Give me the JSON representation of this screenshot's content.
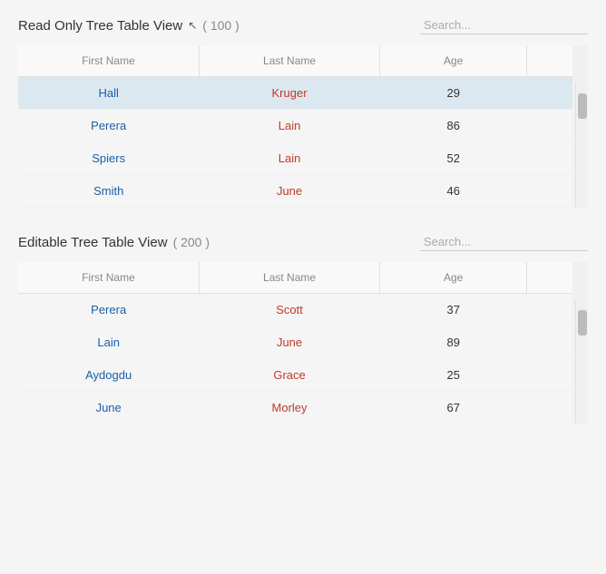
{
  "readOnly": {
    "title": "Read Only Tree Table View",
    "count": "( 100 )",
    "search": {
      "placeholder": "Search...",
      "value": ""
    },
    "columns": [
      "First Name",
      "Last Name",
      "Age"
    ],
    "rows": [
      {
        "firstName": "Hall",
        "lastName": "Kruger",
        "age": "29",
        "selected": true
      },
      {
        "firstName": "Perera",
        "lastName": "Lain",
        "age": "86",
        "selected": false
      },
      {
        "firstName": "Spiers",
        "lastName": "Lain",
        "age": "52",
        "selected": false
      },
      {
        "firstName": "Smith",
        "lastName": "June",
        "age": "46",
        "selected": false
      }
    ]
  },
  "editable": {
    "title": "Editable Tree Table View",
    "count": "( 200 )",
    "search": {
      "placeholder": "Search...",
      "value": ""
    },
    "columns": [
      "First Name",
      "Last Name",
      "Age"
    ],
    "rows": [
      {
        "firstName": "Perera",
        "lastName": "Scott",
        "age": "37",
        "selected": false
      },
      {
        "firstName": "Lain",
        "lastName": "June",
        "age": "89",
        "selected": false
      },
      {
        "firstName": "Aydogdu",
        "lastName": "Grace",
        "age": "25",
        "selected": false
      },
      {
        "firstName": "June",
        "lastName": "Morley",
        "age": "67",
        "selected": false
      }
    ]
  },
  "icons": {
    "cursor": "↖"
  }
}
